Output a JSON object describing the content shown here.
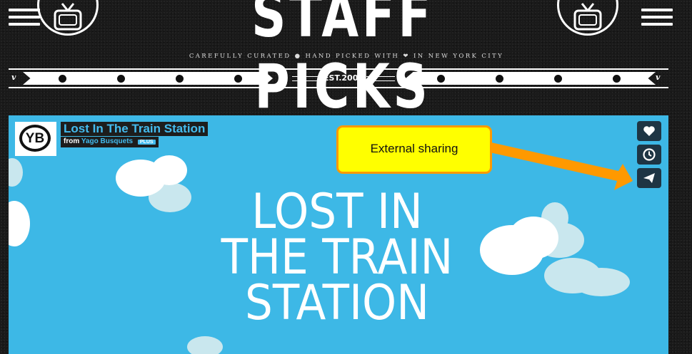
{
  "header": {
    "title": "STAFF PICKS",
    "tagline_before": "CAREFULLY CURATED",
    "tagline_middle": "HAND PICKED WITH",
    "tagline_after": "IN NEW YORK CITY",
    "band_letter": "v",
    "established": "EST.2008"
  },
  "video": {
    "title": "Lost In The Train Station",
    "from_label": "from",
    "author": "Yago Busquets",
    "badge": "PLUS",
    "avatar_initials": "YB",
    "poster_lines": [
      "LOST IN",
      "THE TRAIN",
      "STATION"
    ],
    "background_color": "#3db8e6"
  },
  "side_actions": [
    {
      "icon": "heart-icon"
    },
    {
      "icon": "clock-icon"
    },
    {
      "icon": "paper-plane-icon"
    }
  ],
  "annotation": {
    "label": "External sharing",
    "fill_color": "#ffff00",
    "arrow_color": "#ff9900"
  }
}
